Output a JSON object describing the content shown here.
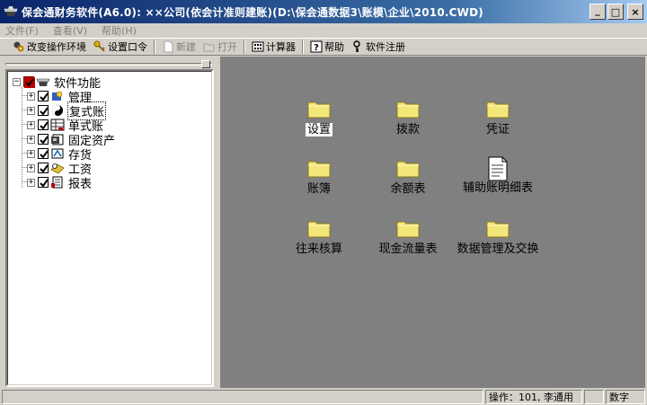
{
  "window": {
    "title": "保会通财务软件(A6.0): ××公司(依会计准则建账)(D:\\保会通数据3\\账模\\企业\\2010.CWD)",
    "controls": {
      "minimize": "_",
      "maximize": "□",
      "close": "×"
    }
  },
  "menu": {
    "items": [
      {
        "label": "文件(F)"
      },
      {
        "label": "查看(V)"
      },
      {
        "label": "帮助(H)"
      }
    ]
  },
  "toolbar": {
    "change_env": "改变操作环境",
    "set_password": "设置口令",
    "new": "新建",
    "open": "打开",
    "calculator": "计算器",
    "help": "帮助",
    "register": "软件注册"
  },
  "tree": {
    "root": {
      "label": "软件功能",
      "expander": "−"
    },
    "items": [
      {
        "label": "管理",
        "icon": "management-icon",
        "expander": "+"
      },
      {
        "label": "复式账",
        "icon": "double-entry-icon",
        "expander": "+"
      },
      {
        "label": "单式账",
        "icon": "single-entry-icon",
        "expander": "+"
      },
      {
        "label": "固定资产",
        "icon": "fixed-assets-icon",
        "expander": "+"
      },
      {
        "label": "存货",
        "icon": "inventory-icon",
        "expander": "+"
      },
      {
        "label": "工资",
        "icon": "payroll-icon",
        "expander": "+"
      },
      {
        "label": "报表",
        "icon": "report-icon",
        "expander": "+"
      }
    ]
  },
  "functions": [
    {
      "label": "设置",
      "icon": "folder-icon"
    },
    {
      "label": "拨款",
      "icon": "folder-icon"
    },
    {
      "label": "凭证",
      "icon": "folder-icon"
    },
    {
      "label": "账簿",
      "icon": "folder-icon"
    },
    {
      "label": "余额表",
      "icon": "folder-icon"
    },
    {
      "label": "辅助账明细表",
      "icon": "document-icon"
    },
    {
      "label": "往来核算",
      "icon": "folder-icon"
    },
    {
      "label": "现金流量表",
      "icon": "folder-icon"
    },
    {
      "label": "数据管理及交换",
      "icon": "folder-icon"
    }
  ],
  "status": {
    "operator": "操作：101, 李通用",
    "mode": "数字"
  },
  "colors": {
    "workspace": "#808080",
    "folder": "#f3e77a",
    "title_start": "#0a246a"
  }
}
